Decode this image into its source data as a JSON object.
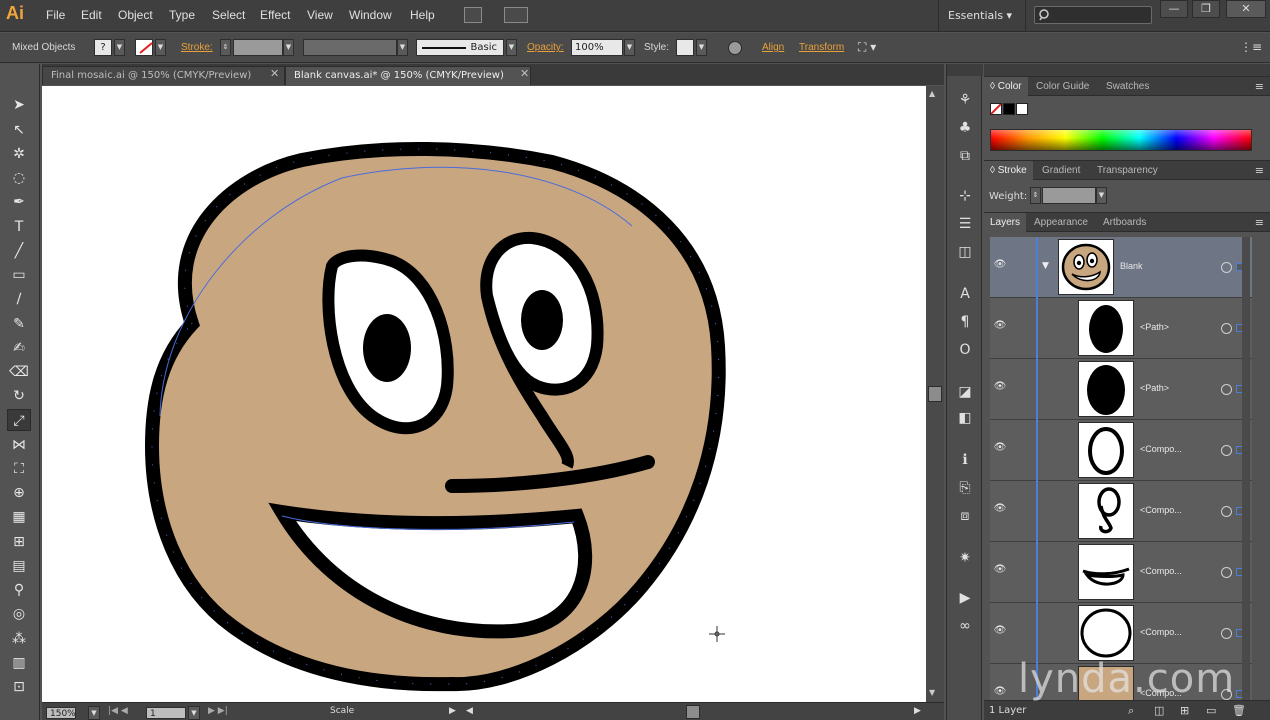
{
  "app": {
    "logo": "Ai"
  },
  "menu": [
    "File",
    "Edit",
    "Object",
    "Type",
    "Select",
    "Effect",
    "View",
    "Window",
    "Help"
  ],
  "workspace": "Essentials",
  "window_controls": {
    "minimize": "—",
    "restore": "❐",
    "close": "✕"
  },
  "control_bar": {
    "selection": "Mixed Objects",
    "stroke_label": "Stroke:",
    "brush": "Basic",
    "opacity_label": "Opacity:",
    "opacity_value": "100%",
    "style_label": "Style:",
    "align_link": "Align",
    "transform_link": "Transform"
  },
  "tabs": [
    {
      "label": "Final mosaic.ai @ 150% (CMYK/Preview)",
      "active": false
    },
    {
      "label": "Blank canvas.ai* @ 150% (CMYK/Preview)",
      "active": true
    }
  ],
  "status_bar": {
    "zoom": "150%",
    "artboard": "1",
    "tool": "Scale"
  },
  "panels": {
    "color_group": [
      "Color",
      "Color Guide",
      "Swatches"
    ],
    "stroke_group": [
      "Stroke",
      "Gradient",
      "Transparency"
    ],
    "weight_label": "Weight:",
    "layers_group": [
      "Layers",
      "Appearance",
      "Artboards"
    ]
  },
  "layers": {
    "items": [
      {
        "name": "Blank",
        "thumb": "face"
      },
      {
        "name": "<Path>",
        "thumb": "pupil"
      },
      {
        "name": "<Path>",
        "thumb": "pupil"
      },
      {
        "name": "<Compo...",
        "thumb": "eye-outline"
      },
      {
        "name": "<Compo...",
        "thumb": "eye-curl"
      },
      {
        "name": "<Compo...",
        "thumb": "mouth"
      },
      {
        "name": "<Compo...",
        "thumb": "head"
      },
      {
        "name": "<Compo...",
        "thumb": "face"
      }
    ],
    "count": "1 Layer"
  },
  "watermark": "lynda.com",
  "colors": {
    "face_fill": "#c8a680",
    "path_highlight": "#4a6cdc",
    "accent": "#e8a03a"
  }
}
